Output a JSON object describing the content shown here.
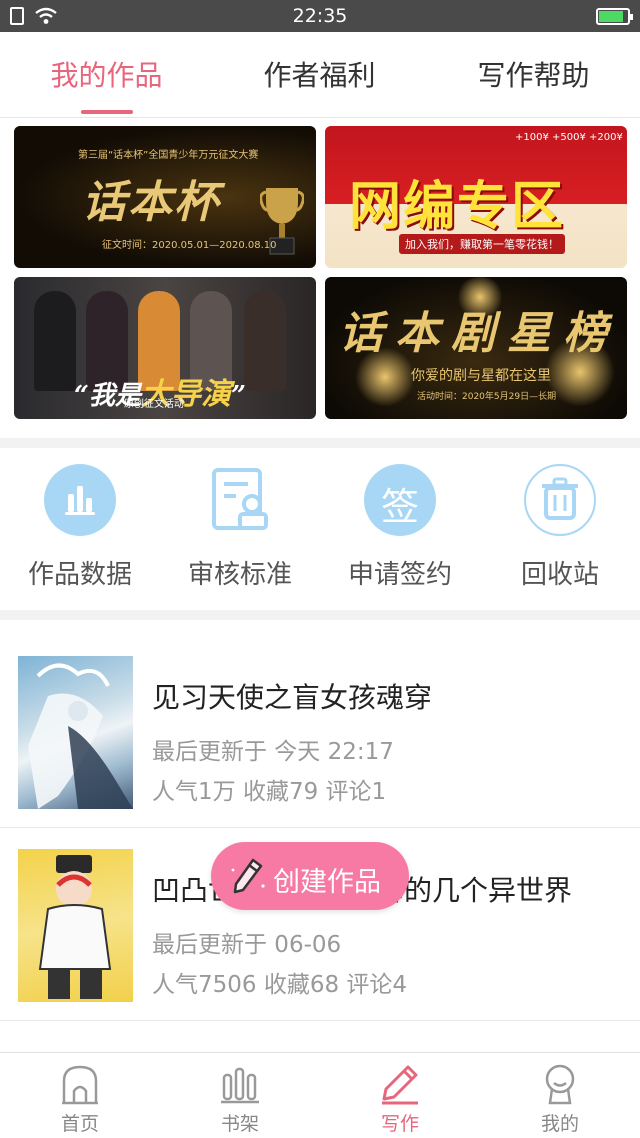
{
  "status_bar": {
    "time": "22:35"
  },
  "tabs": [
    {
      "label": "我的作品",
      "active": true
    },
    {
      "label": "作者福利",
      "active": false
    },
    {
      "label": "写作帮助",
      "active": false
    }
  ],
  "banners": {
    "b1": {
      "headline": "话本杯",
      "subtitle": "第三届“话本杯”全国青少年万元征文大赛",
      "date": "征文时间：2020.05.01—2020.08.10"
    },
    "b2": {
      "headline": "网编专区",
      "bonus": "+100¥ +500¥ +200¥",
      "tagline": "加入我们，赚取第一笔零花钱！"
    },
    "b3": {
      "headline_prefix": "“我是",
      "headline_main": "大导演",
      "headline_suffix": "”",
      "subtitle": "原创征文活动"
    },
    "b4": {
      "headline": "话本剧星榜",
      "subtitle": "你爱的剧与星都在这里",
      "date": "活动时间：2020年5月29日—长期"
    }
  },
  "quick_actions": [
    {
      "label": "作品数据",
      "icon": "bar-chart-icon"
    },
    {
      "label": "审核标准",
      "icon": "review-document-icon"
    },
    {
      "label": "申请签约",
      "icon": "sign-icon",
      "glyph": "签"
    },
    {
      "label": "回收站",
      "icon": "trash-icon"
    }
  ],
  "works": [
    {
      "title": "见习天使之盲女孩魂穿",
      "updated": "最后更新于 今天 22:17",
      "stats": "人气1万 收藏79 评论1"
    },
    {
      "title": "凹凸世界之我和雷狮的几个异世界",
      "updated": "最后更新于 06-06",
      "stats": "人气7506 收藏68 评论4"
    }
  ],
  "fab": {
    "label": "创建作品"
  },
  "bottom_nav": [
    {
      "label": "首页",
      "icon": "home-icon",
      "active": false
    },
    {
      "label": "书架",
      "icon": "bookshelf-icon",
      "active": false
    },
    {
      "label": "写作",
      "icon": "pencil-icon",
      "active": true
    },
    {
      "label": "我的",
      "icon": "profile-icon",
      "active": false
    }
  ],
  "colors": {
    "accent": "#e8667c",
    "fab": "#f77aa5",
    "icon_blue": "#a8d7f6"
  }
}
